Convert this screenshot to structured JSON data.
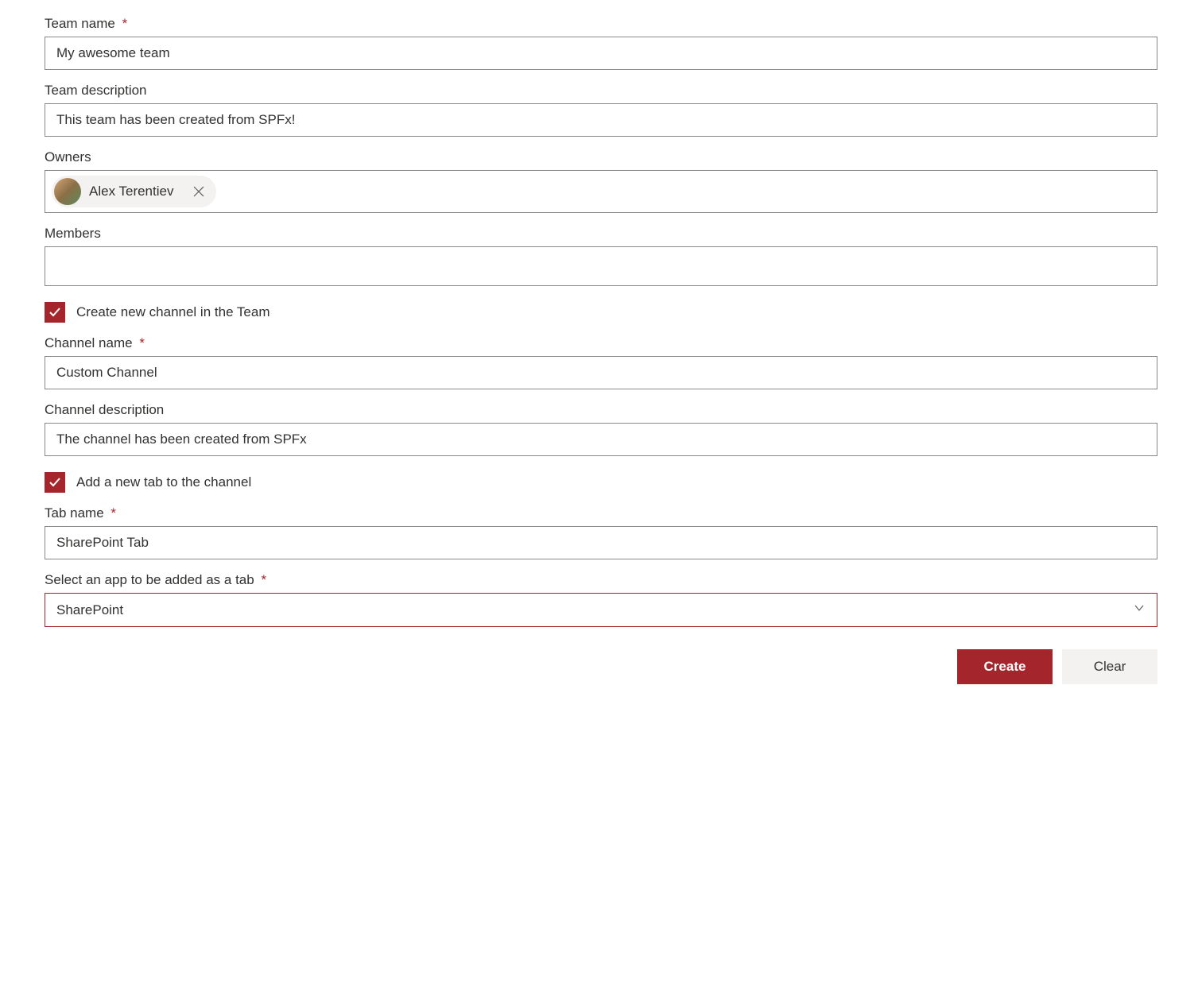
{
  "accentColor": "#a4262c",
  "teamName": {
    "label": "Team name",
    "required": true,
    "value": "My awesome team"
  },
  "teamDescription": {
    "label": "Team description",
    "value": "This team has been created from SPFx!"
  },
  "owners": {
    "label": "Owners",
    "people": [
      {
        "name": "Alex Terentiev"
      }
    ]
  },
  "members": {
    "label": "Members",
    "people": []
  },
  "createChannelCheckbox": {
    "label": "Create new channel in the Team",
    "checked": true
  },
  "channelName": {
    "label": "Channel name",
    "required": true,
    "value": "Custom Channel"
  },
  "channelDescription": {
    "label": "Channel description",
    "value": "The channel has been created from SPFx"
  },
  "addTabCheckbox": {
    "label": "Add a new tab to the channel",
    "checked": true
  },
  "tabName": {
    "label": "Tab name",
    "required": true,
    "value": "SharePoint Tab"
  },
  "appSelect": {
    "label": "Select an app to be added as a tab",
    "required": true,
    "selected": "SharePoint"
  },
  "buttons": {
    "create": "Create",
    "clear": "Clear"
  },
  "requiredMark": "*"
}
